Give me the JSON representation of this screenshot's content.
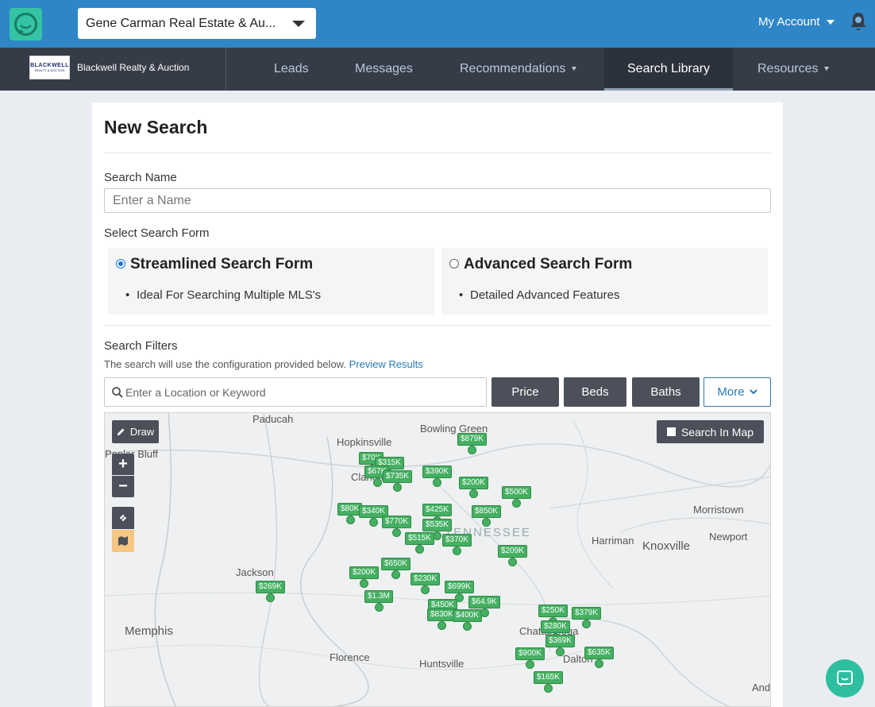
{
  "topbar": {
    "account_selector": "Gene Carman Real Estate & Au...",
    "my_account": "My Account"
  },
  "navbar": {
    "brand_logo_text_line1": "BLACKWELL",
    "brand_logo_text_line2": "REALTY & AUCTION",
    "brand_name": "Blackwell Realty & Auction",
    "items": [
      "Leads",
      "Messages",
      "Recommendations",
      "Search Library",
      "Resources"
    ],
    "active": "Search Library"
  },
  "page": {
    "title": "New Search",
    "search_name_label": "Search Name",
    "search_name_placeholder": "Enter a Name",
    "select_form_label": "Select Search Form",
    "forms": [
      {
        "title": "Streamlined Search Form",
        "bullet": "Ideal For Searching Multiple MLS's",
        "selected": true
      },
      {
        "title": "Advanced Search Form",
        "bullet": "Detailed Advanced Features",
        "selected": false
      }
    ],
    "filters_label": "Search Filters",
    "filters_help": "The search will use the configuration provided below.",
    "preview_link": "Preview Results",
    "location_placeholder": "Enter a Location or Keyword",
    "filter_buttons": [
      "Price",
      "Beds",
      "Baths"
    ],
    "more_button": "More"
  },
  "map": {
    "draw_button": "Draw",
    "search_in_map": "Search In Map",
    "zoom_in": "+",
    "zoom_out": "−",
    "cities": [
      "Paducah",
      "Bowling Green",
      "Hopkinsville",
      "Clarksville",
      "Jackson",
      "Memphis",
      "Florence",
      "Huntsville",
      "Harriman",
      "Knoxville",
      "Morristown",
      "Newport",
      "Chattanooga",
      "Dalton",
      "Poplar Bluff",
      "And"
    ],
    "state_label": "TENNESSEE",
    "price_pins": [
      "$879K",
      "$70K",
      "$315K",
      "$67K",
      "$735K",
      "$390K",
      "$200K",
      "$500K",
      "$80K",
      "$340K",
      "$770K",
      "$425K",
      "$850K",
      "$535K",
      "$515K",
      "$370K",
      "$209K",
      "$650K",
      "$200K",
      "$230K",
      "$699K",
      "$269K",
      "$1.3M",
      "$450K",
      "$830K",
      "$400K",
      "$64.9K",
      "$250K",
      "$379K",
      "$280K",
      "$369K",
      "$900K",
      "$635K",
      "$165K"
    ]
  },
  "colors": {
    "topbar": "#2e86c7",
    "navbar": "#363c47",
    "pin": "#45b062",
    "accent": "#2a7ab8"
  }
}
